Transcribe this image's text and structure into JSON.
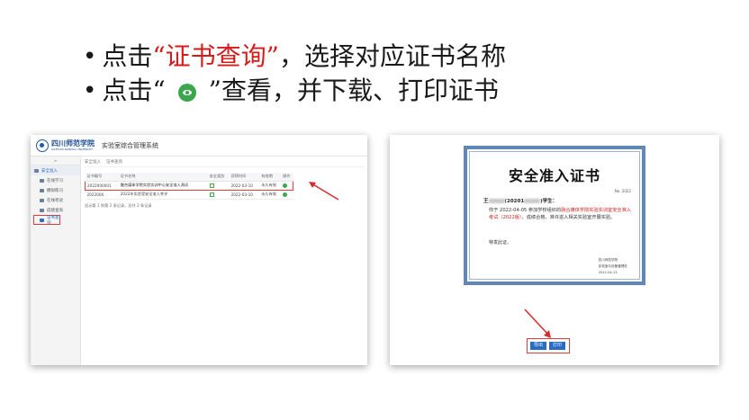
{
  "slide": {
    "bullet1_prefix": "点击",
    "bullet1_highlight": "“证书查询”",
    "bullet1_suffix": "，选择对应证书名称",
    "bullet2_prefix": "点击“",
    "bullet2_icon": "eye-view-icon",
    "bullet2_suffix": "”查看，并下载、打印证书",
    "bullet_char": "•",
    "highlight_color": "#d71a1a"
  },
  "app": {
    "logo_cn": "四川师范学院",
    "logo_en": "SICHUAN NORMAL UNIVERSITY",
    "title": "实验室综合管理系统",
    "breadcrumb": [
      "安全准入",
      "证书查询"
    ],
    "sidebar": {
      "menu_head": "≡",
      "parent": "安全准入",
      "items": [
        "在线学习",
        "模拟练习",
        "在线考试",
        "成绩查询",
        "证书查询"
      ]
    },
    "table": {
      "headers": [
        "证书编号",
        "证书名称",
        "安全类别",
        "获得时间",
        "有效期",
        "操作"
      ],
      "rows": [
        {
          "no": "2022000001",
          "name": "融合媒体学院实验实训中心安全准入测试",
          "date": "2022-03-10",
          "validity": "永久有效"
        },
        {
          "no": "2022000",
          "name": "2022年实验室安全准入考评",
          "date": "2022-03-10",
          "validity": "永久有效"
        }
      ],
      "pager": "显示第 1 到第 2 条记录，总共 2 条记录"
    }
  },
  "certificate": {
    "title": "安全准入证书",
    "number_label": "No: 2022",
    "recipient": "王",
    "recipient_mid": "(20201",
    "recipient_end": ")学生：",
    "body_prefix": "你于 2022-04-05 参加学校组织的",
    "body_highlight": "融合媒体学院实验实训室安全准入考试（2022版）",
    "body_suffix": "，成绩合格，准许进入相关实验室开展实验。",
    "closing": "特发此证。",
    "sign_line1": "四川师范学院",
    "sign_line2": "实验室与设备管理处",
    "sign_date": "2022-04-13",
    "buttons": [
      "导出",
      "打印"
    ],
    "border_color": "#5f88b8"
  }
}
